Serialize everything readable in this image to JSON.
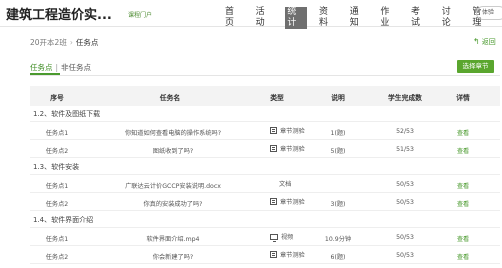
{
  "header": {
    "title": "建筑工程造价实...",
    "subtitle": "课程门户",
    "nav": [
      "首页",
      "活动",
      "统计",
      "资料",
      "通知",
      "作业",
      "考试",
      "讨论",
      "管理"
    ],
    "active_nav": "统计",
    "user": "体验",
    "accent": "#5aa62e"
  },
  "breadcrumb": {
    "class_name": "20开本2班",
    "sep": "›",
    "current": "任务点",
    "back_label": "返回"
  },
  "tabs": {
    "active": "任务点",
    "sep": "|",
    "other": "非任务点",
    "select_button": "选择章节"
  },
  "table": {
    "headers": {
      "seq": "序号",
      "name": "任务名",
      "type": "类型",
      "desc": "说明",
      "count": "学生完成数",
      "detail": "详情"
    },
    "sections": [
      {
        "title": "1.2、软件及图纸下载",
        "rows": [
          {
            "seq": "任务点1",
            "name": "你知道如何查看电脑的操作系统吗?",
            "type": "章节测验",
            "type_icon": "quiz-icon",
            "desc": "1(题)",
            "count": "52/53",
            "detail": "查看"
          },
          {
            "seq": "任务点2",
            "name": "图纸收到了吗?",
            "type": "章节测验",
            "type_icon": "quiz-icon",
            "desc": "5(题)",
            "count": "51/53",
            "detail": "查看"
          }
        ]
      },
      {
        "title": "1.3、软件安装",
        "rows": [
          {
            "seq": "任务点1",
            "name": "广联达云计价GCCP安装说明.docx",
            "type": "文档",
            "type_icon": "",
            "desc": "",
            "count": "50/53",
            "detail": "查看"
          },
          {
            "seq": "任务点2",
            "name": "你真的安装成功了吗?",
            "type": "章节测验",
            "type_icon": "quiz-icon",
            "desc": "3(题)",
            "count": "50/53",
            "detail": "查看"
          }
        ]
      },
      {
        "title": "1.4、软件界面介绍",
        "rows": [
          {
            "seq": "任务点1",
            "name": "软件界面介绍.mp4",
            "type": "视频",
            "type_icon": "video-icon",
            "desc": "10.9分钟",
            "count": "50/53",
            "detail": "查看"
          },
          {
            "seq": "任务点2",
            "name": "你会新建了吗?",
            "type": "章节测验",
            "type_icon": "quiz-icon",
            "desc": "6(题)",
            "count": "50/53",
            "detail": "查看"
          }
        ]
      }
    ]
  }
}
